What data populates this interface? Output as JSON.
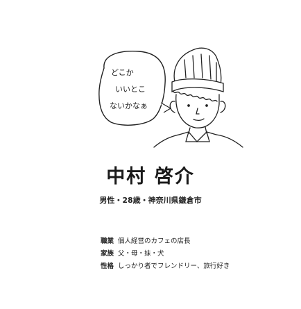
{
  "speech_bubble": {
    "line1": "どこか",
    "line2": "いいとこ",
    "line3": "ないかなぁ"
  },
  "profile": {
    "name": "中村 啓介",
    "subtitle": "男性・28歳・神奈川県鎌倉市",
    "details": [
      {
        "label": "職業",
        "value": "個人経営のカフェの店長"
      },
      {
        "label": "家族",
        "value": "父・母・妹・犬"
      },
      {
        "label": "性格",
        "value": "しっかり者でフレンドリー、旅行好き"
      }
    ]
  }
}
